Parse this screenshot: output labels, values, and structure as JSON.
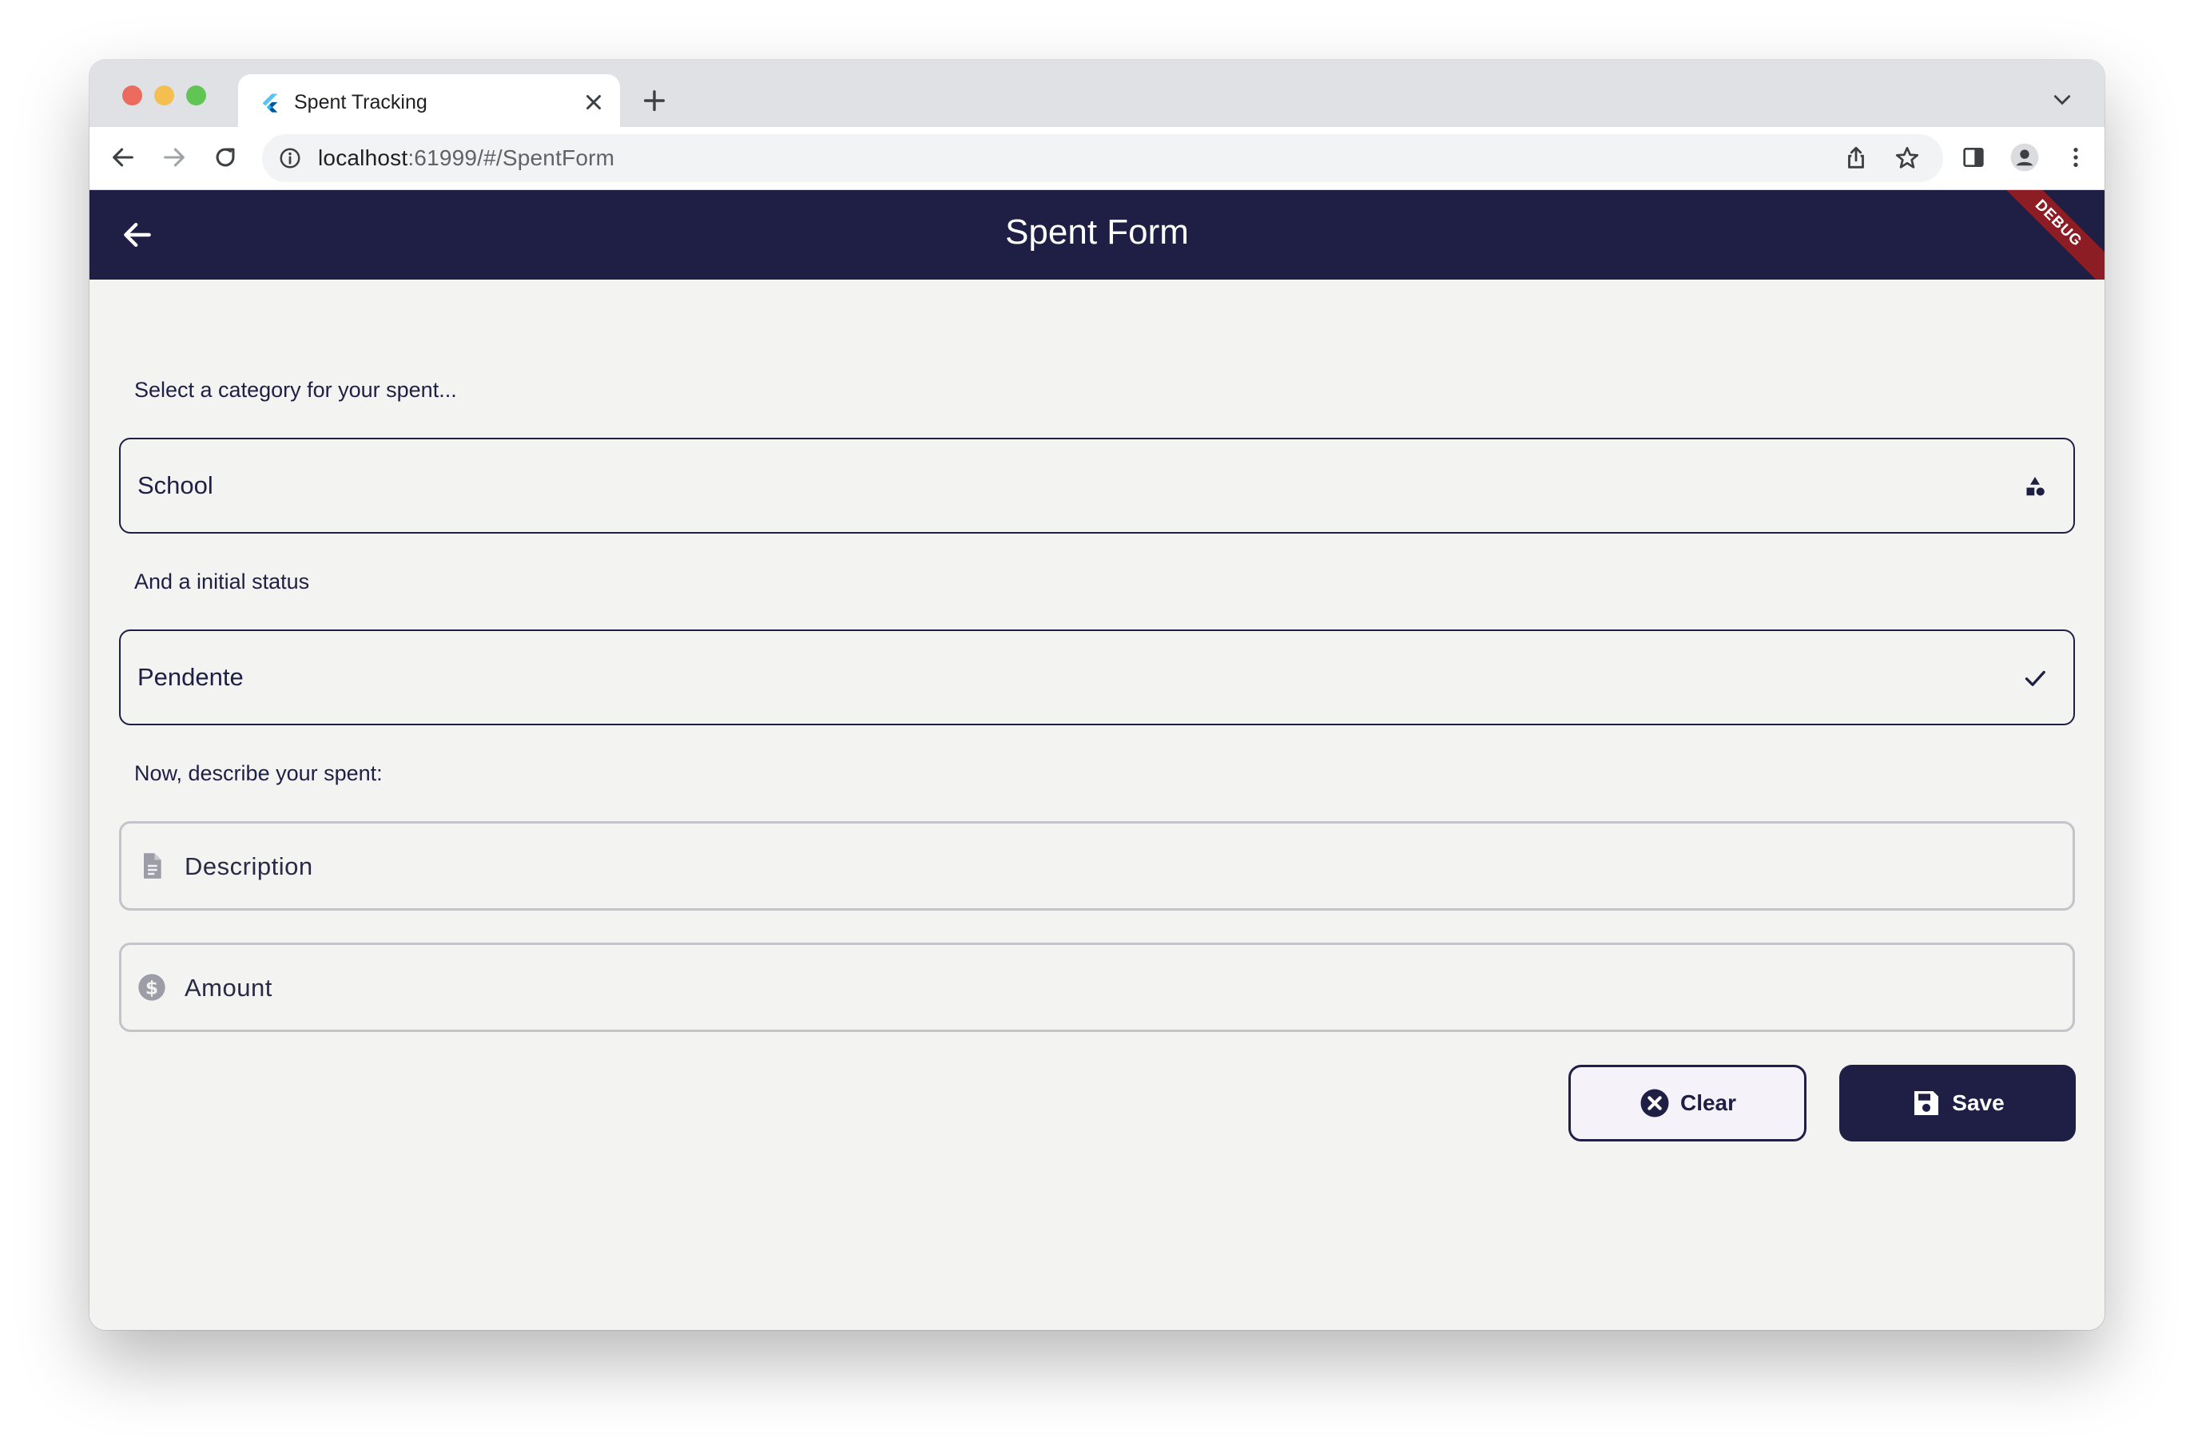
{
  "browser": {
    "tab_title": "Spent Tracking",
    "url_host": "localhost",
    "url_path": ":61999/#/SpentForm"
  },
  "app": {
    "title": "Spent Form",
    "debug_banner": "DEBUG",
    "bar_color": "#1f1f46"
  },
  "form": {
    "category_prompt": "Select a category for your spent...",
    "category_value": "School",
    "status_prompt": "And a initial status",
    "status_value": "Pendente",
    "describe_prompt": "Now, describe your spent:",
    "description_placeholder": "Description",
    "amount_placeholder": "Amount"
  },
  "actions": {
    "clear_label": "Clear",
    "save_label": "Save"
  },
  "icons": {
    "category": "category-shapes-icon",
    "status": "check-icon",
    "description": "document-icon",
    "amount": "dollar-circle-icon",
    "clear": "cancel-circle-icon",
    "save": "floppy-disk-icon"
  }
}
